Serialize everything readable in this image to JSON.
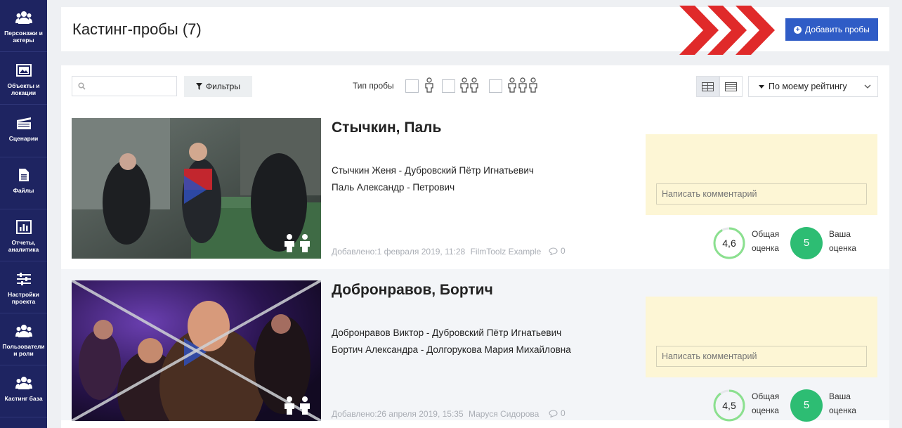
{
  "sidebar": {
    "items": [
      {
        "label": "Персонажи и актеры",
        "icon": "users-icon"
      },
      {
        "label": "Объекты и локации",
        "icon": "image-icon"
      },
      {
        "label": "Сценарии",
        "icon": "clapperboard-icon"
      },
      {
        "label": "Файлы",
        "icon": "file-icon"
      },
      {
        "label": "Отчеты, аналитика",
        "icon": "bar-chart-icon"
      },
      {
        "label": "Настройки проекта",
        "icon": "sliders-icon"
      },
      {
        "label": "Пользователи и роли",
        "icon": "users-icon"
      },
      {
        "label": "Кастинг база",
        "icon": "users-icon"
      }
    ]
  },
  "header": {
    "title": "Кастинг-пробы (7)",
    "add_button": "Добавить пробы"
  },
  "toolbar": {
    "search_placeholder": "",
    "filters_label": "Фильтры",
    "type_label": "Тип пробы",
    "sort_label": "По моему рейтингу"
  },
  "auditions": [
    {
      "title": "Стычкин, Паль",
      "roles": [
        "Стычкин Женя - Дубровский Пётр Игнатьевич",
        "Паль Александр - Петрович"
      ],
      "added": "Добавлено:1 февраля 2019, 11:28",
      "author": "FilmToolz Example",
      "comments": "0",
      "comment_placeholder": "Написать комментарий",
      "avg_score": "4,6",
      "avg_fraction": 0.92,
      "avg_caption": [
        "Общая",
        "оценка"
      ],
      "my_score": "5",
      "my_caption": [
        "Ваша",
        "оценка"
      ],
      "crossed": false
    },
    {
      "title": "Добронравов, Бортич",
      "roles": [
        "Добронравов Виктор - Дубровский Пётр Игнатьевич",
        "Бортич Александра - Долгорукова Мария Михайловна"
      ],
      "added": "Добавлено:26 апреля 2019, 15:35",
      "author": "Маруся Сидорова",
      "comments": "0",
      "comment_placeholder": "Написать комментарий",
      "avg_score": "4,5",
      "avg_fraction": 0.9,
      "avg_caption": [
        "Общая",
        "оценка"
      ],
      "my_score": "5",
      "my_caption": [
        "Ваша",
        "оценка"
      ],
      "crossed": true
    }
  ],
  "colors": {
    "sidebar": "#1e2461",
    "primary_button": "#2f5cc6",
    "chevrons": "#e02a2a",
    "score_green": "#2dbd73",
    "comment_bg": "#fdf6d5"
  }
}
